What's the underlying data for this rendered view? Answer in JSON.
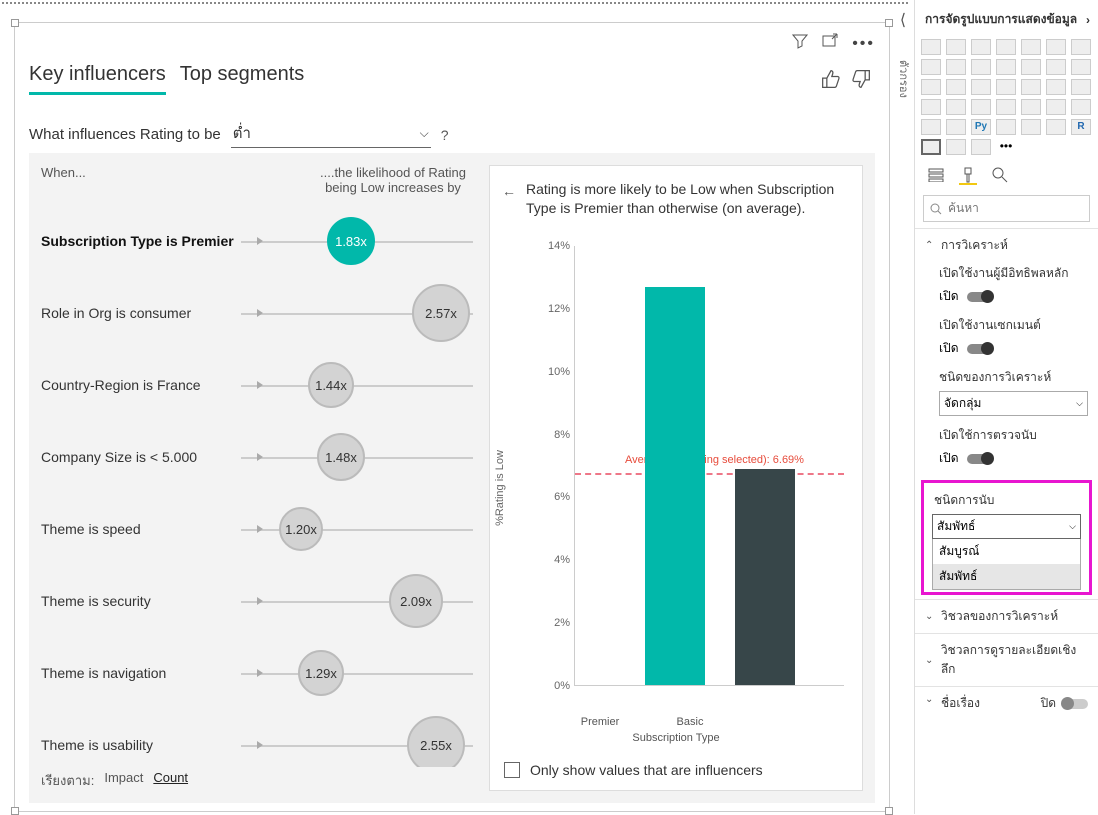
{
  "vizTabs": {
    "keyInfluencers": "Key influencers",
    "topSegments": "Top segments"
  },
  "question": {
    "prefix": "What influences Rating to be",
    "value": "ต่ำ",
    "help": "?"
  },
  "leftHeaders": {
    "when": "When...",
    "likely": "....the likelihood of Rating being Low increases by"
  },
  "influencers": [
    {
      "label": "Subscription Type is Premier",
      "value": "1.83x",
      "bubble": 48,
      "pos": 310,
      "selected": true
    },
    {
      "label": "Role in Org is consumer",
      "value": "2.57x",
      "bubble": 58,
      "pos": 400,
      "selected": false
    },
    {
      "label": "Country-Region is France",
      "value": "1.44x",
      "bubble": 46,
      "pos": 290,
      "selected": false
    },
    {
      "label": "Company Size is < 5.000",
      "value": "1.48x",
      "bubble": 48,
      "pos": 300,
      "selected": false
    },
    {
      "label": "Theme is speed",
      "value": "1.20x",
      "bubble": 44,
      "pos": 260,
      "selected": false
    },
    {
      "label": "Theme is security",
      "value": "2.09x",
      "bubble": 54,
      "pos": 375,
      "selected": false
    },
    {
      "label": "Theme is navigation",
      "value": "1.29x",
      "bubble": 46,
      "pos": 280,
      "selected": false
    },
    {
      "label": "Theme is usability",
      "value": "2.55x",
      "bubble": 58,
      "pos": 395,
      "selected": false
    }
  ],
  "sortBy": {
    "label": "เรียงตาม:",
    "impact": "Impact",
    "count": "Count"
  },
  "detail": {
    "text": "Rating is more likely to be Low when Subscription Type is Premier than otherwise (on average).",
    "annotation": "Average (excluding selected): 6.69%",
    "avgValue": 6.69,
    "checkbox": "Only show values that are influencers"
  },
  "chart_data": {
    "type": "bar",
    "title": "",
    "xlabel": "Subscription Type",
    "ylabel": "%Rating is Low",
    "ylim": [
      0,
      14
    ],
    "yticks": [
      "0%",
      "2%",
      "4%",
      "6%",
      "8%",
      "10%",
      "12%",
      "14%"
    ],
    "categories": [
      "Premier",
      "Basic"
    ],
    "values": [
      12.7,
      6.9
    ],
    "colors": [
      "#01b8aa",
      "#374649"
    ]
  },
  "rail": {
    "title": "การจัดรูปแบบการแสดงข้อมูล",
    "sideTab": "ตัวกรอง",
    "searchPlaceholder": "ค้นหา",
    "sections": {
      "analysis": {
        "title": "การวิเคราะห์",
        "enableKey": "เปิดใช้งานผู้มีอิทธิพลหลัก",
        "enableSeg": "เปิดใช้งานเซกเมนต์",
        "toggleOn": "เปิด",
        "analysisTypeLabel": "ชนิดของการวิเคราะห์",
        "analysisTypeValue": "จัดกลุ่ม",
        "enableCount": "เปิดใช้การตรวจนับ",
        "countTypeLabel": "ชนิดการนับ",
        "countTypeValue": "สัมพัทธ์",
        "options": [
          "สัมบูรณ์",
          "สัมพัทธ์"
        ]
      },
      "visAnalysis": "วิชวลของการวิเคราะห์",
      "visDrill": "วิชวลการดูรายละเอียดเชิงลึก",
      "titleSection": {
        "label": "ชื่อเรื่อง",
        "state": "ปิด"
      }
    }
  }
}
